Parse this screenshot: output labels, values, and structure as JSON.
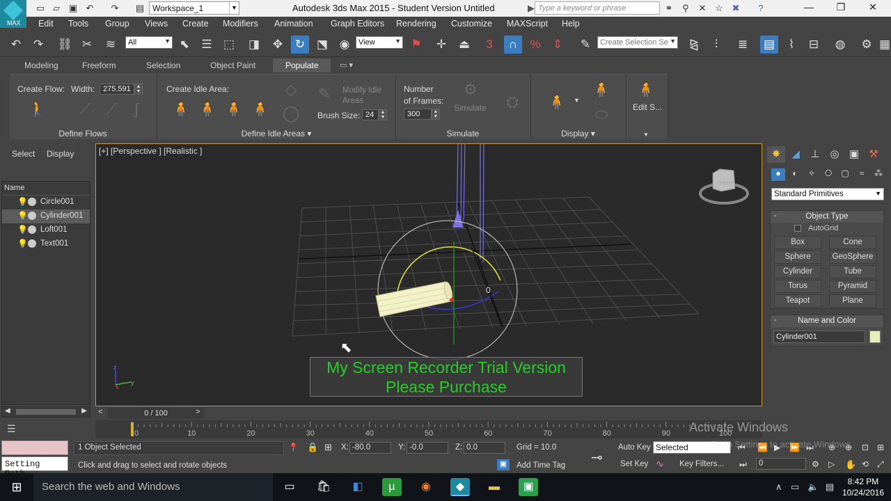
{
  "titlebar": {
    "logo_text": "MAX",
    "workspace": "Workspace_1",
    "app_title": "Autodesk 3ds Max  2015  - Student Version    Untitled",
    "search_placeholder": "Type a keyword or phrase"
  },
  "menu": [
    "Edit",
    "Tools",
    "Group",
    "Views",
    "Create",
    "Modifiers",
    "Animation",
    "Graph Editors",
    "Rendering",
    "Customize",
    "MAXScript",
    "Help"
  ],
  "main_toolbar": {
    "filter": "All",
    "ref_coord": "View",
    "snap_label": "3",
    "selection_set_placeholder": "Create Selection Se"
  },
  "ribbon_tabs": [
    "Modeling",
    "Freeform",
    "Selection",
    "Object Paint",
    "Populate"
  ],
  "ribbon": {
    "create_flow": "Create Flow:",
    "width_label": "Width:",
    "width_value": "275.591",
    "create_idle_area": "Create Idle Area:",
    "modify_idle_areas": "Modify Idle Areas",
    "brush_size_label": "Brush Size:",
    "brush_size_value": "24",
    "frames_label_1": "Number",
    "frames_label_2": "of Frames:",
    "frames_value": "300",
    "simulate_btn": "Simulate",
    "edit_selected": "Edit S...",
    "groups": [
      "Define Flows",
      "Define Idle Areas ▾",
      "Simulate",
      "Display ▾"
    ]
  },
  "explorer": {
    "tabs": [
      "Select",
      "Display"
    ],
    "col_header": "Name",
    "objects": [
      {
        "name": "Circle001",
        "selected": false
      },
      {
        "name": "Cylinder001",
        "selected": true
      },
      {
        "name": "Loft001",
        "selected": false
      },
      {
        "name": "Text001",
        "selected": false
      }
    ]
  },
  "viewport": {
    "label": "[+] [Perspective ] [Realistic ]",
    "watermark_line1": "My Screen Recorder Trial Version",
    "watermark_line2": "Please Purchase",
    "viewcube_label": "RIGHT"
  },
  "command_panel": {
    "category": "Standard Primitives",
    "object_type_title": "Object Type",
    "autogrid": "AutoGrid",
    "primitives": [
      "Box",
      "Cone",
      "Sphere",
      "GeoSphere",
      "Cylinder",
      "Tube",
      "Torus",
      "Pyramid",
      "Teapot",
      "Plane"
    ],
    "name_color_title": "Name and Color",
    "object_name": "Cylinder001",
    "object_color": "#e6efb8"
  },
  "timeline": {
    "frame_display": "0 / 100",
    "prev": "<",
    "next": ">",
    "ticks": [
      "0",
      "10",
      "20",
      "30",
      "40",
      "50",
      "60",
      "70",
      "80",
      "90",
      "100"
    ]
  },
  "status": {
    "setting_path": "Setting Path",
    "selected_count": "1 Object Selected",
    "prompt": "Click and drag to select and rotate objects",
    "x_label": "X:",
    "x_value": "-80.0",
    "y_label": "Y:",
    "y_value": "-0.0",
    "z_label": "Z:",
    "z_value": "0.0",
    "grid": "Grid = 10.0",
    "add_time_tag": "Add Time Tag",
    "auto_key": "Auto Key",
    "key_mode": "Selected",
    "set_key": "Set Key",
    "key_filters": "Key Filters...",
    "current_frame": "0"
  },
  "activation": {
    "line1": "Activate Windows",
    "line2": "Go to Settings to activate Windows."
  },
  "taskbar": {
    "search": "Search the web and Windows",
    "time": "8:42 PM",
    "date": "10/24/2016"
  }
}
